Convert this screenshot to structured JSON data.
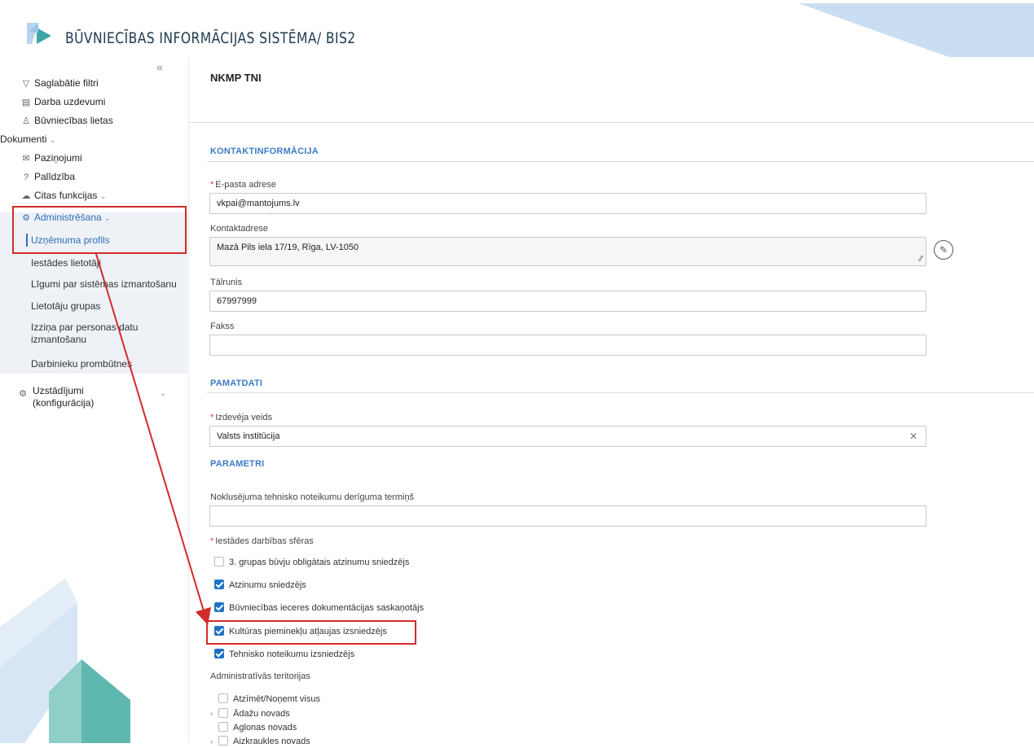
{
  "header": {
    "title": "BŪVNIECĪBAS INFORMĀCIJAS SISTĒMA/ BIS2"
  },
  "sidebar": {
    "collapse_icon": "«",
    "items": [
      {
        "label": "Saglabātie filtri",
        "icon": "filter-icon"
      },
      {
        "label": "Darba uzdevumi",
        "icon": "clipboard-icon"
      },
      {
        "label": "Būvniecības lietas",
        "icon": "person-icon"
      },
      {
        "label": "Dokumenti",
        "icon": ""
      },
      {
        "label": "Paziņojumi",
        "icon": "message-icon"
      },
      {
        "label": "Palīdzība",
        "icon": "help-icon"
      },
      {
        "label": "Citas funkcijas",
        "icon": "cloud-icon"
      },
      {
        "label": "Administrēšana",
        "icon": "admin-icon"
      }
    ],
    "admin_sub": [
      "Uzņēmuma profils",
      "Iestādes lietotāji",
      "Līgumi par sistēmas izmantošanu",
      "Lietotāju grupas",
      "Izziņa par personas datu izmantošanu",
      "Darbinieku prombūtnes"
    ],
    "settings": "Uzstādījumi (konfigurācija)",
    "accent_color": "#2f6fb5"
  },
  "main": {
    "title": "NKMP TNI",
    "sections": {
      "contact": "KONTAKTINFORMĀCIJA",
      "basic": "PAMATDATI",
      "params": "PARAMETRI"
    },
    "fields": {
      "email_label": "E-pasta adrese",
      "email_value": "vkpai@mantojums.lv",
      "address_label": "Kontaktadrese",
      "address_value": "Mazā Pils iela 17/19, Rīga, LV-1050",
      "phone_label": "Tālrunis",
      "phone_value": "67997999",
      "fax_label": "Fakss",
      "fax_value": "",
      "issuer_type_label": "Izdevēja veids",
      "issuer_type_value": "Valsts institūcija",
      "default_term_label": "Noklusējuma tehnisko noteikumu derīguma termiņš",
      "default_term_value": "",
      "spheres_label": "Iestādes darbības sfēras",
      "territories_label": "Administratīvās teritorijas"
    },
    "spheres": [
      {
        "label": "3. grupas būvju obligātais atzinumu sniedzējs",
        "checked": false
      },
      {
        "label": "Atzinumu sniedzējs",
        "checked": true
      },
      {
        "label": "Būvniecības ieceres dokumentācijas saskaņotājs",
        "checked": true
      },
      {
        "label": "Kultūras pieminekļu atļaujas izsniedzējs",
        "checked": true
      },
      {
        "label": "Tehnisko noteikumu izsniedzējs",
        "checked": true
      }
    ],
    "territories": {
      "select_all": "Atzīmēt/Noņemt visus",
      "items": [
        "Ādažu novads",
        "Aglonas novads",
        "Aizkraukles novads"
      ]
    }
  },
  "highlight_color": "#d22b2b"
}
